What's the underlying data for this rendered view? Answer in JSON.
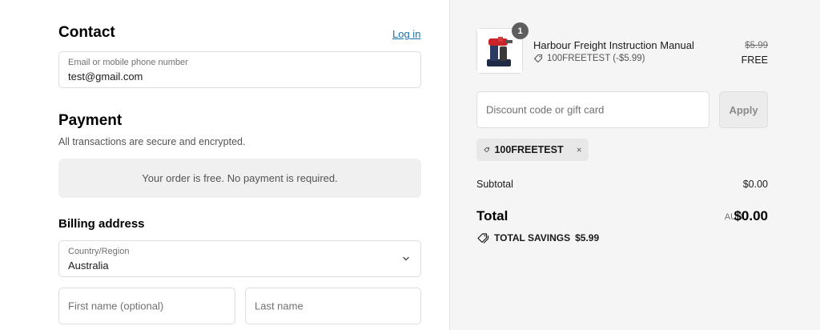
{
  "contact": {
    "heading": "Contact",
    "login_link": "Log in",
    "email_label": "Email or mobile phone number",
    "email_value": "test@gmail.com"
  },
  "payment": {
    "heading": "Payment",
    "subtext": "All transactions are secure and encrypted.",
    "notice": "Your order is free. No payment is required."
  },
  "billing": {
    "heading": "Billing address",
    "country_label": "Country/Region",
    "country_value": "Australia",
    "first_name_placeholder": "First name (optional)",
    "last_name_placeholder": "Last name"
  },
  "summary": {
    "item": {
      "quantity": "1",
      "name": "Harbour Freight Instruction Manual",
      "discount": "100FREETEST (-$5.99)",
      "original_price": "$5.99",
      "price": "FREE"
    },
    "discount_placeholder": "Discount code or gift card",
    "apply_label": "Apply",
    "applied_code": "100FREETEST",
    "subtotal_label": "Subtotal",
    "subtotal_value": "$0.00",
    "total_label": "Total",
    "currency": "AUD",
    "total_value": "$0.00",
    "savings_label": "TOTAL SAVINGS",
    "savings_value": "$5.99"
  },
  "colors": {
    "link": "#1773b0",
    "summary_bg": "#f5f5f5"
  },
  "icons": [
    "chevron-down-icon",
    "tag-icon",
    "close-icon",
    "product-image"
  ]
}
